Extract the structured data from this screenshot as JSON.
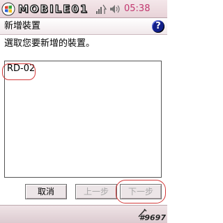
{
  "status_bar": {
    "brand": "MOBILE01",
    "clock": "05:38",
    "icons": [
      "signal-icon",
      "volume-icon"
    ]
  },
  "title_bar": {
    "title": "新增裝置",
    "help_icon": "?"
  },
  "content": {
    "instruction": "選取您要新增的裝置。",
    "devices": [
      "RD-02"
    ]
  },
  "buttons": {
    "cancel": "取消",
    "back": "上一步",
    "next": "下一步"
  },
  "watermark": "#9697",
  "colors": {
    "clock": "#c2376f",
    "highlight": "#d33a3a",
    "help": "#12208a"
  }
}
